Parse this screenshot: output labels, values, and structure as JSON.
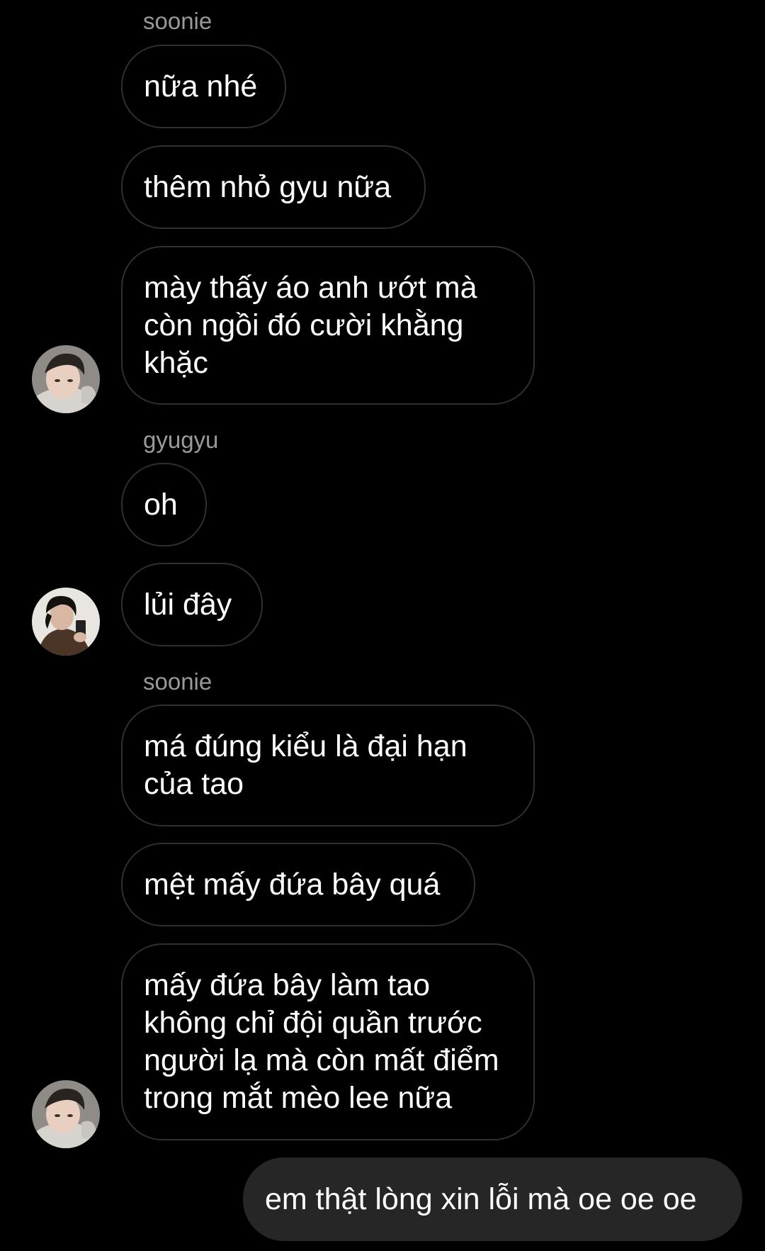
{
  "conversation": {
    "groups": [
      {
        "sender": "soonie",
        "avatar_icon": "user-avatar-soonie-icon",
        "messages": [
          "nữa nhé",
          "thêm nhỏ gyu nữa",
          "mày thấy áo anh ướt mà còn ngồi đó cười khằng khặc"
        ]
      },
      {
        "sender": "gyugyu",
        "avatar_icon": "user-avatar-gyugyu-icon",
        "messages": [
          "oh",
          "lủi đây"
        ]
      },
      {
        "sender": "soonie",
        "avatar_icon": "user-avatar-soonie-icon",
        "messages": [
          "má đúng kiểu là đại hạn của tao",
          "mệt mấy đứa bây quá",
          "mấy đứa bây làm tao không chỉ đội quần trước người lạ mà còn mất điểm trong mắt mèo lee nữa"
        ]
      }
    ],
    "outgoing": [
      "em thật lòng xin lỗi mà oe oe oe"
    ]
  },
  "colors": {
    "background": "#000000",
    "incoming_border": "#2f2f2f",
    "outgoing_bubble": "#262626",
    "sender_name": "#9a9a9a",
    "text": "#ffffff"
  }
}
